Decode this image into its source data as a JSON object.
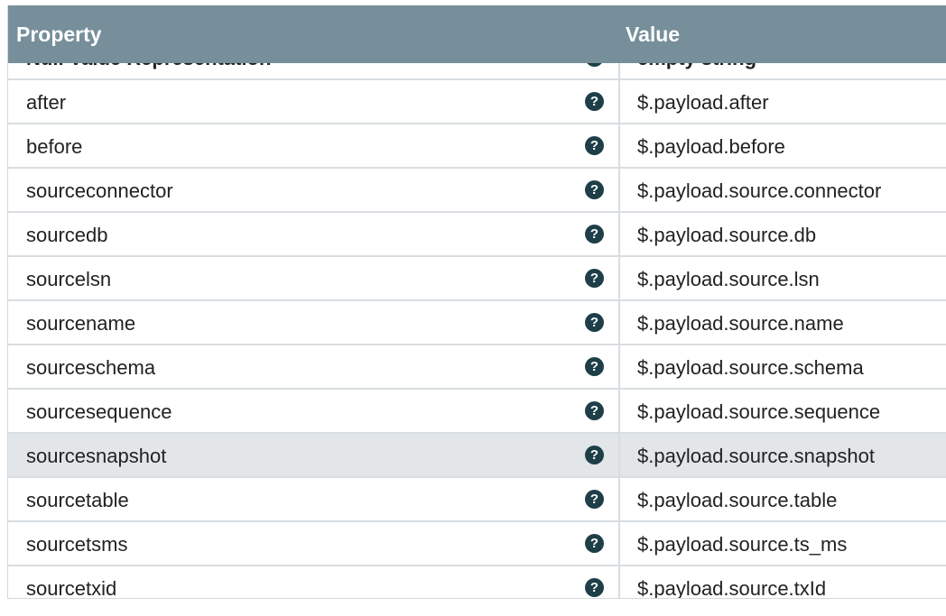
{
  "header": {
    "property_label": "Property",
    "value_label": "Value"
  },
  "rows": [
    {
      "property": "Null Value Representation",
      "value": "empty string",
      "help_icon": "question-circle-icon"
    },
    {
      "property": "after",
      "value": "$.payload.after",
      "help_icon": "question-circle-icon"
    },
    {
      "property": "before",
      "value": "$.payload.before",
      "help_icon": "question-circle-icon"
    },
    {
      "property": "sourceconnector",
      "value": "$.payload.source.connector",
      "help_icon": "question-circle-icon"
    },
    {
      "property": "sourcedb",
      "value": "$.payload.source.db",
      "help_icon": "question-circle-icon"
    },
    {
      "property": "sourcelsn",
      "value": "$.payload.source.lsn",
      "help_icon": "question-circle-icon"
    },
    {
      "property": "sourcename",
      "value": "$.payload.source.name",
      "help_icon": "question-circle-icon"
    },
    {
      "property": "sourceschema",
      "value": "$.payload.source.schema",
      "help_icon": "question-circle-icon"
    },
    {
      "property": "sourcesequence",
      "value": "$.payload.source.sequence",
      "help_icon": "question-circle-icon"
    },
    {
      "property": "sourcesnapshot",
      "value": "$.payload.source.snapshot",
      "help_icon": "question-circle-icon",
      "hovered": true
    },
    {
      "property": "sourcetable",
      "value": "$.payload.source.table",
      "help_icon": "question-circle-icon"
    },
    {
      "property": "sourcetsms",
      "value": "$.payload.source.ts_ms",
      "help_icon": "question-circle-icon"
    },
    {
      "property": "sourcetxid",
      "value": "$.payload.source.txId",
      "help_icon": "question-circle-icon"
    }
  ],
  "help_glyph": "?",
  "colors": {
    "header_bg": "#768f9b",
    "header_text": "#ffffff",
    "help_icon_bg": "#1e3f48",
    "row_hover_bg": "#e2e6e9",
    "row_border": "#d8dde1"
  }
}
